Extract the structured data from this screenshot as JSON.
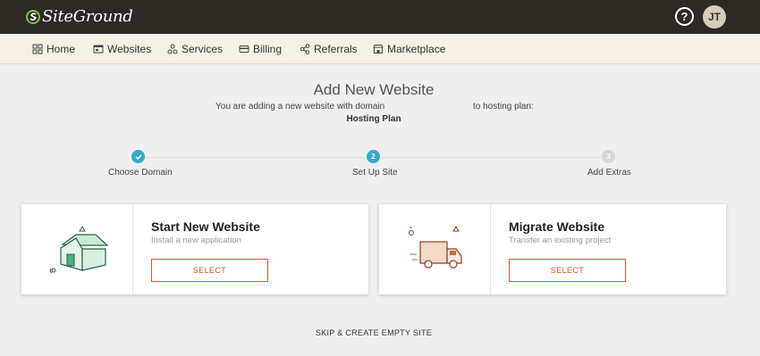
{
  "brand": {
    "name": "SiteGround",
    "logo_icon": "siteground-logo-icon"
  },
  "topbar": {
    "help_label": "?",
    "avatar_initials": "JT"
  },
  "nav": {
    "items": [
      {
        "label": "Home",
        "icon": "grid-icon"
      },
      {
        "label": "Websites",
        "icon": "browser-window-icon"
      },
      {
        "label": "Services",
        "icon": "services-icon"
      },
      {
        "label": "Billing",
        "icon": "credit-card-icon"
      },
      {
        "label": "Referrals",
        "icon": "share-icon"
      },
      {
        "label": "Marketplace",
        "icon": "store-icon"
      }
    ]
  },
  "header": {
    "title": "Add New Website",
    "intro_text": "You are adding a new website with domain",
    "plan_text": "to hosting plan:",
    "plan_name": "Hosting Plan"
  },
  "stepper": {
    "steps": [
      {
        "number": "1",
        "label": "Choose Domain",
        "state": "completed"
      },
      {
        "number": "2",
        "label": "Set Up Site",
        "state": "current"
      },
      {
        "number": "3",
        "label": "Add Extras",
        "state": "upcoming"
      }
    ]
  },
  "cards": [
    {
      "title": "Start New Website",
      "subtitle": "Install a new application",
      "button": "SELECT",
      "illustration": "house-icon"
    },
    {
      "title": "Migrate Website",
      "subtitle": "Transfer an existing project",
      "button": "SELECT",
      "illustration": "moving-truck-icon"
    }
  ],
  "skip_link": "SKIP & CREATE EMPTY SITE",
  "colors": {
    "topbar": "#2d2a26",
    "nav_bg": "#f5f1e4",
    "accent_teal": "#3ba7c9",
    "button_orange": "#d9542b",
    "house_green": "#4caf7d",
    "truck_orange": "#c9663f"
  }
}
